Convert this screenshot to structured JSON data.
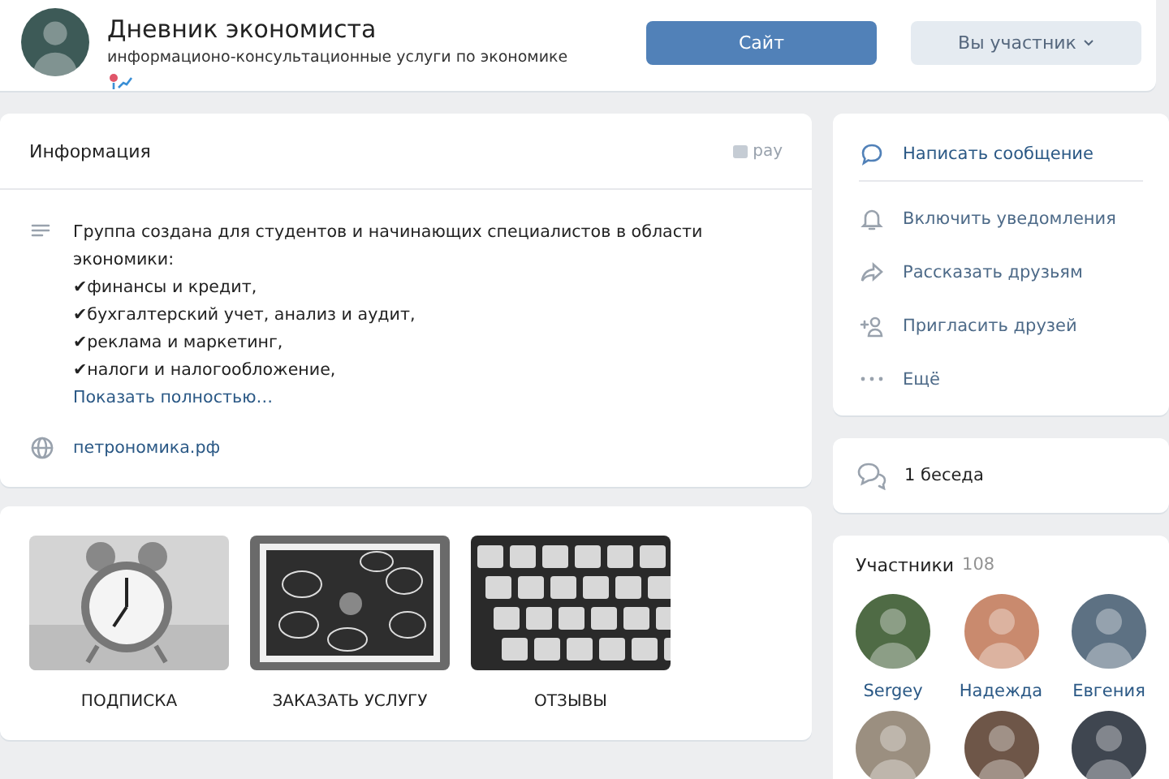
{
  "group": {
    "title": "Дневник экономиста",
    "subtitle": "информационо-консультационные услуги по экономике"
  },
  "header_buttons": [
    {
      "label": "Сайт",
      "kind": "primary"
    },
    {
      "label": "Вы участник",
      "kind": "secondary"
    }
  ],
  "info": {
    "title": "Информация",
    "pay_link": "pay",
    "description": [
      "Группа создана для студентов и начинающих специалистов в области экономики:",
      "✔финансы и кредит,",
      "✔бухгалтерский учет, анализ и аудит,",
      "✔реклама и маркетинг,",
      "✔налоги и налогообложение,"
    ],
    "show_more": "Показать полностью…",
    "website": "петрономика.рф"
  },
  "tiles": [
    {
      "label": "ПОДПИСКА"
    },
    {
      "label": "ЗАКАЗАТЬ УСЛУГУ"
    },
    {
      "label": "ОТЗЫВЫ"
    }
  ],
  "actions": [
    {
      "label": "Написать сообщение",
      "kind": "message"
    },
    {
      "label": "Включить уведомления",
      "kind": "bell"
    },
    {
      "label": "Рассказать друзьям",
      "kind": "share"
    },
    {
      "label": "Пригласить друзей",
      "kind": "invite"
    },
    {
      "label": "Ещё",
      "kind": "more"
    }
  ],
  "conversations": {
    "label": "1 беседа"
  },
  "members": {
    "title": "Участники",
    "count": "108",
    "people": [
      {
        "name": "Sergey",
        "color": "#4f6b45"
      },
      {
        "name": "Надежда",
        "color": "#c98a6e"
      },
      {
        "name": "Евгения",
        "color": "#5d7183"
      },
      {
        "color": "#9b8f80"
      },
      {
        "color": "#6e5648"
      },
      {
        "color": "#3f4650"
      }
    ]
  }
}
